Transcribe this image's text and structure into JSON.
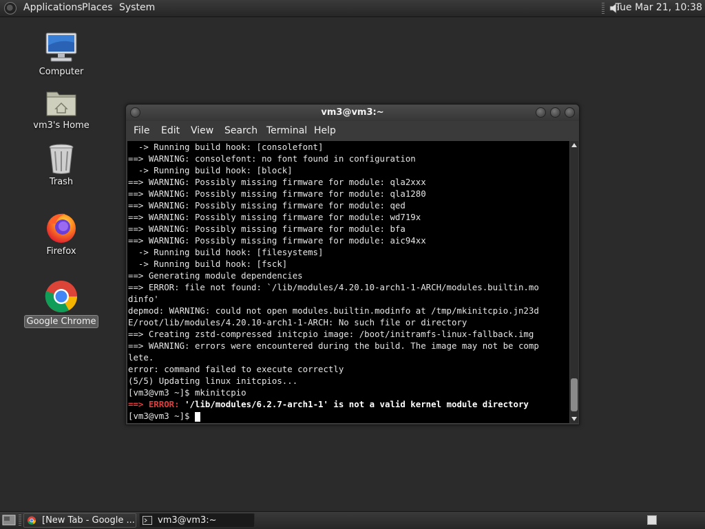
{
  "top_panel": {
    "menus": [
      "Applications",
      "Places",
      "System"
    ],
    "clock": "Tue Mar 21, 10:38",
    "volume_icon": "speaker-icon"
  },
  "desktop": {
    "icons": [
      {
        "label": "Computer",
        "icon": "computer-icon"
      },
      {
        "label": "vm3's Home",
        "icon": "home-folder-icon"
      },
      {
        "label": "Trash",
        "icon": "trash-icon"
      },
      {
        "label": "Firefox",
        "icon": "firefox-icon"
      },
      {
        "label": "Google Chrome",
        "icon": "chrome-icon",
        "selected": true
      }
    ]
  },
  "terminal": {
    "title": "vm3@vm3:~",
    "menu": [
      "File",
      "Edit",
      "View",
      "Search",
      "Terminal",
      "Help"
    ],
    "lines": [
      "  -> Running build hook: [consolefont]",
      "==> WARNING: consolefont: no font found in configuration",
      "  -> Running build hook: [block]",
      "==> WARNING: Possibly missing firmware for module: qla2xxx",
      "==> WARNING: Possibly missing firmware for module: qla1280",
      "==> WARNING: Possibly missing firmware for module: qed",
      "==> WARNING: Possibly missing firmware for module: wd719x",
      "==> WARNING: Possibly missing firmware for module: bfa",
      "==> WARNING: Possibly missing firmware for module: aic94xx",
      "  -> Running build hook: [filesystems]",
      "  -> Running build hook: [fsck]",
      "==> Generating module dependencies",
      "==> ERROR: file not found: `/lib/modules/4.20.10-arch1-1-ARCH/modules.builtin.mo",
      "dinfo'",
      "depmod: WARNING: could not open modules.builtin.modinfo at /tmp/mkinitcpio.jn23d",
      "E/root/lib/modules/4.20.10-arch1-1-ARCH: No such file or directory",
      "==> Creating zstd-compressed initcpio image: /boot/initramfs-linux-fallback.img",
      "==> WARNING: errors were encountered during the build. The image may not be comp",
      "lete.",
      "error: command failed to execute correctly",
      "(5/5) Updating linux initcpios...",
      "[vm3@vm3 ~]$ mkinitcpio"
    ],
    "error_line": {
      "prefix": "==> ERROR:",
      "message": " '/lib/modules/6.2.7-arch1-1' is not a valid kernel module directory"
    },
    "prompt": "[vm3@vm3 ~]$ "
  },
  "bottom_panel": {
    "tasks": [
      {
        "label": "[New Tab - Google ...",
        "icon": "chrome-icon"
      },
      {
        "label": "vm3@vm3:~",
        "icon": "terminal-icon",
        "active": true
      }
    ]
  },
  "colors": {
    "desktop_bg": "#2b2b2b",
    "terminal_bg": "#000000",
    "error_red": "#e23b3b"
  }
}
